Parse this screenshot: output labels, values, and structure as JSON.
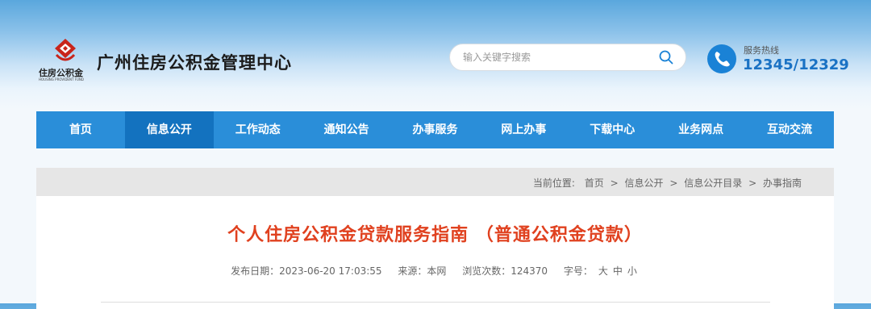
{
  "header": {
    "logo_text": "住房公积金",
    "logo_sub": "HOUSING PROVIDENT FUND",
    "site_title": "广州住房公积金管理中心",
    "search_placeholder": "输入关键字搜索",
    "hotline_label": "服务热线",
    "hotline_number": "12345/12329",
    "colors": {
      "brand_red": "#c8241b",
      "accent_blue": "#1a82d6"
    }
  },
  "nav": {
    "items": [
      {
        "label": "首页"
      },
      {
        "label": "信息公开"
      },
      {
        "label": "工作动态"
      },
      {
        "label": "通知公告"
      },
      {
        "label": "办事服务"
      },
      {
        "label": "网上办事"
      },
      {
        "label": "下载中心"
      },
      {
        "label": "业务网点"
      },
      {
        "label": "互动交流"
      }
    ],
    "active": "信息公开"
  },
  "breadcrumb": {
    "label": "当前位置:",
    "items": [
      "首页",
      "信息公开",
      "信息公开目录",
      "办事指南"
    ],
    "separator": ">"
  },
  "article": {
    "title": "个人住房公积金贷款服务指南 （普通公积金贷款）",
    "publish_label": "发布日期：",
    "publish_date": "2023-06-20 17:03:55",
    "source_label": "来源：",
    "source": "本网",
    "views_label": "浏览次数：",
    "views": "124370",
    "size_label": "字号：",
    "sizes": [
      "大",
      "中",
      "小"
    ]
  }
}
